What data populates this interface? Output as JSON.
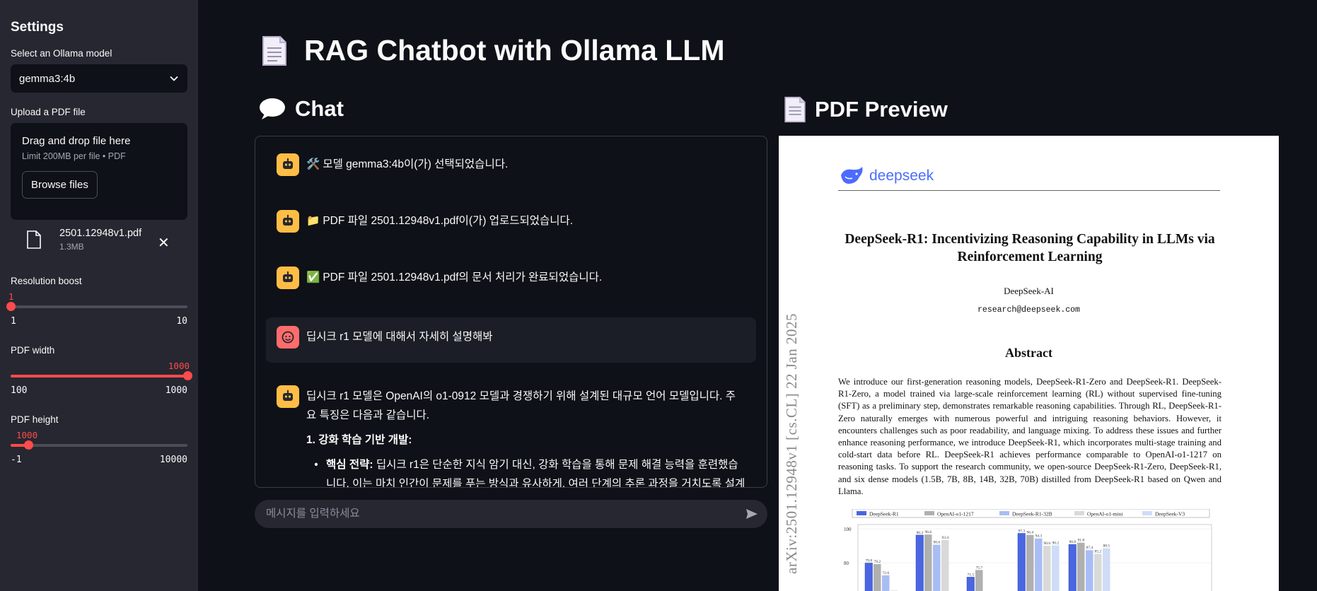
{
  "sidebar": {
    "title": "Settings",
    "model_label": "Select an Ollama model",
    "model_value": "gemma3:4b",
    "upload_label": "Upload a PDF file",
    "upload_main": "Drag and drop file here",
    "upload_sub": "Limit 200MB per file • PDF",
    "browse_label": "Browse files",
    "file_name": "2501.12948v1.pdf",
    "file_size": "1.3MB",
    "sliders": [
      {
        "label": "Resolution boost",
        "value": "1",
        "min": "1",
        "max": "10",
        "fraction": 0.0
      },
      {
        "label": "PDF width",
        "value": "1000",
        "min": "100",
        "max": "1000",
        "fraction": 1.0
      },
      {
        "label": "PDF height",
        "value": "1000",
        "min": "-1",
        "max": "10000",
        "fraction": 0.1
      }
    ]
  },
  "header": {
    "title": "RAG Chatbot with Ollama LLM"
  },
  "chat": {
    "heading": "Chat",
    "messages": [
      {
        "role": "assistant",
        "emoji": "🛠️",
        "text": "모델 gemma3:4b이(가) 선택되었습니다."
      },
      {
        "role": "assistant",
        "emoji": "📁",
        "text": "PDF 파일 2501.12948v1.pdf이(가) 업로드되었습니다."
      },
      {
        "role": "assistant",
        "emoji": "✅",
        "text": "PDF 파일 2501.12948v1.pdf의 문서 처리가 완료되었습니다."
      },
      {
        "role": "user",
        "text": "딥시크 r1 모델에 대해서 자세히 설명해봐"
      },
      {
        "role": "assistant",
        "text": "딥시크 r1 모델은 OpenAI의 o1-0912 모델과 경쟁하기 위해 설계된 대규모 언어 모델입니다. 주요 특징은 다음과 같습니다.",
        "list_head": "1. 강화 학습 기반 개발:",
        "bullet_bold": "핵심 전략:",
        "bullet_text": "딥시크 r1은 단순한 지식 암기 대신, 강화 학습을 통해 문제 해결 능력을 훈련했습니다. 이는 마치 인간이 문제를 푸는 방식과 유사하게, 여러 단계의 추론 과정을 거치도록 설계되"
      }
    ],
    "input_placeholder": "메시지를 입력하세요"
  },
  "pdf_preview": {
    "heading": "PDF Preview",
    "logo_text": "deepseek",
    "title": "DeepSeek-R1: Incentivizing Reasoning Capability in LLMs via Reinforcement Learning",
    "author": "DeepSeek-AI",
    "email": "research@deepseek.com",
    "abstract_heading": "Abstract",
    "abstract": "We introduce our first-generation reasoning models, DeepSeek-R1-Zero and DeepSeek-R1. DeepSeek-R1-Zero, a model trained via large-scale reinforcement learning (RL) without supervised fine-tuning (SFT) as a preliminary step, demonstrates remarkable reasoning capabilities. Through RL, DeepSeek-R1-Zero naturally emerges with numerous powerful and intriguing reasoning behaviors. However, it encounters challenges such as poor readability, and language mixing. To address these issues and further enhance reasoning performance, we introduce DeepSeek-R1, which incorporates multi-stage training and cold-start data before RL. DeepSeek-R1 achieves performance comparable to OpenAI-o1-1217 on reasoning tasks. To support the research community, we open-source DeepSeek-R1-Zero, DeepSeek-R1, and six dense models (1.5B, 7B, 8B, 14B, 32B, 70B) distilled from DeepSeek-R1 based on Qwen and Llama.",
    "side_stamp": "arXiv:2501.12948v1  [cs.CL]  22 Jan 2025",
    "figure": {
      "legend": [
        "DeepSeek-R1",
        "OpenAI-o1-1217",
        "DeepSeek-R1-32B",
        "OpenAI-o1-mini",
        "DeepSeek-V3"
      ],
      "colors": [
        "#4a66e0",
        "#b0b0b0",
        "#a9bdf5",
        "#d9d9d9",
        "#cfdcf7"
      ],
      "y_ticks": [
        "100",
        "80"
      ],
      "groups": [
        [
          79.8,
          79.2,
          72.6,
          63.6,
          39.2
        ],
        [
          96.3,
          96.6,
          90.6,
          93.4,
          58.7
        ],
        [
          71.5,
          75.7,
          62.1,
          60.0,
          59.1
        ],
        [
          97.3,
          96.4,
          94.3,
          90.0,
          90.2
        ],
        [
          90.8,
          91.8,
          87.4,
          85.2,
          88.5
        ]
      ],
      "labels": [
        [
          "79.8",
          "79.2",
          "72.6"
        ],
        [
          "96.3",
          "96.6",
          "90.6",
          "93.4"
        ],
        [
          "71.5",
          "75.7"
        ],
        [
          "97.3",
          "96.4",
          "94.3",
          "90.0",
          "90.2"
        ],
        [
          "90.8",
          "91.8",
          "87.4",
          "85.2",
          "88.5"
        ]
      ]
    }
  },
  "colors": {
    "accent": "#ff4b4b",
    "bot_avatar": "#ffbd45",
    "user_avatar": "#ff6c6c",
    "sidebar_bg": "#262730",
    "main_bg": "#0e1117"
  }
}
